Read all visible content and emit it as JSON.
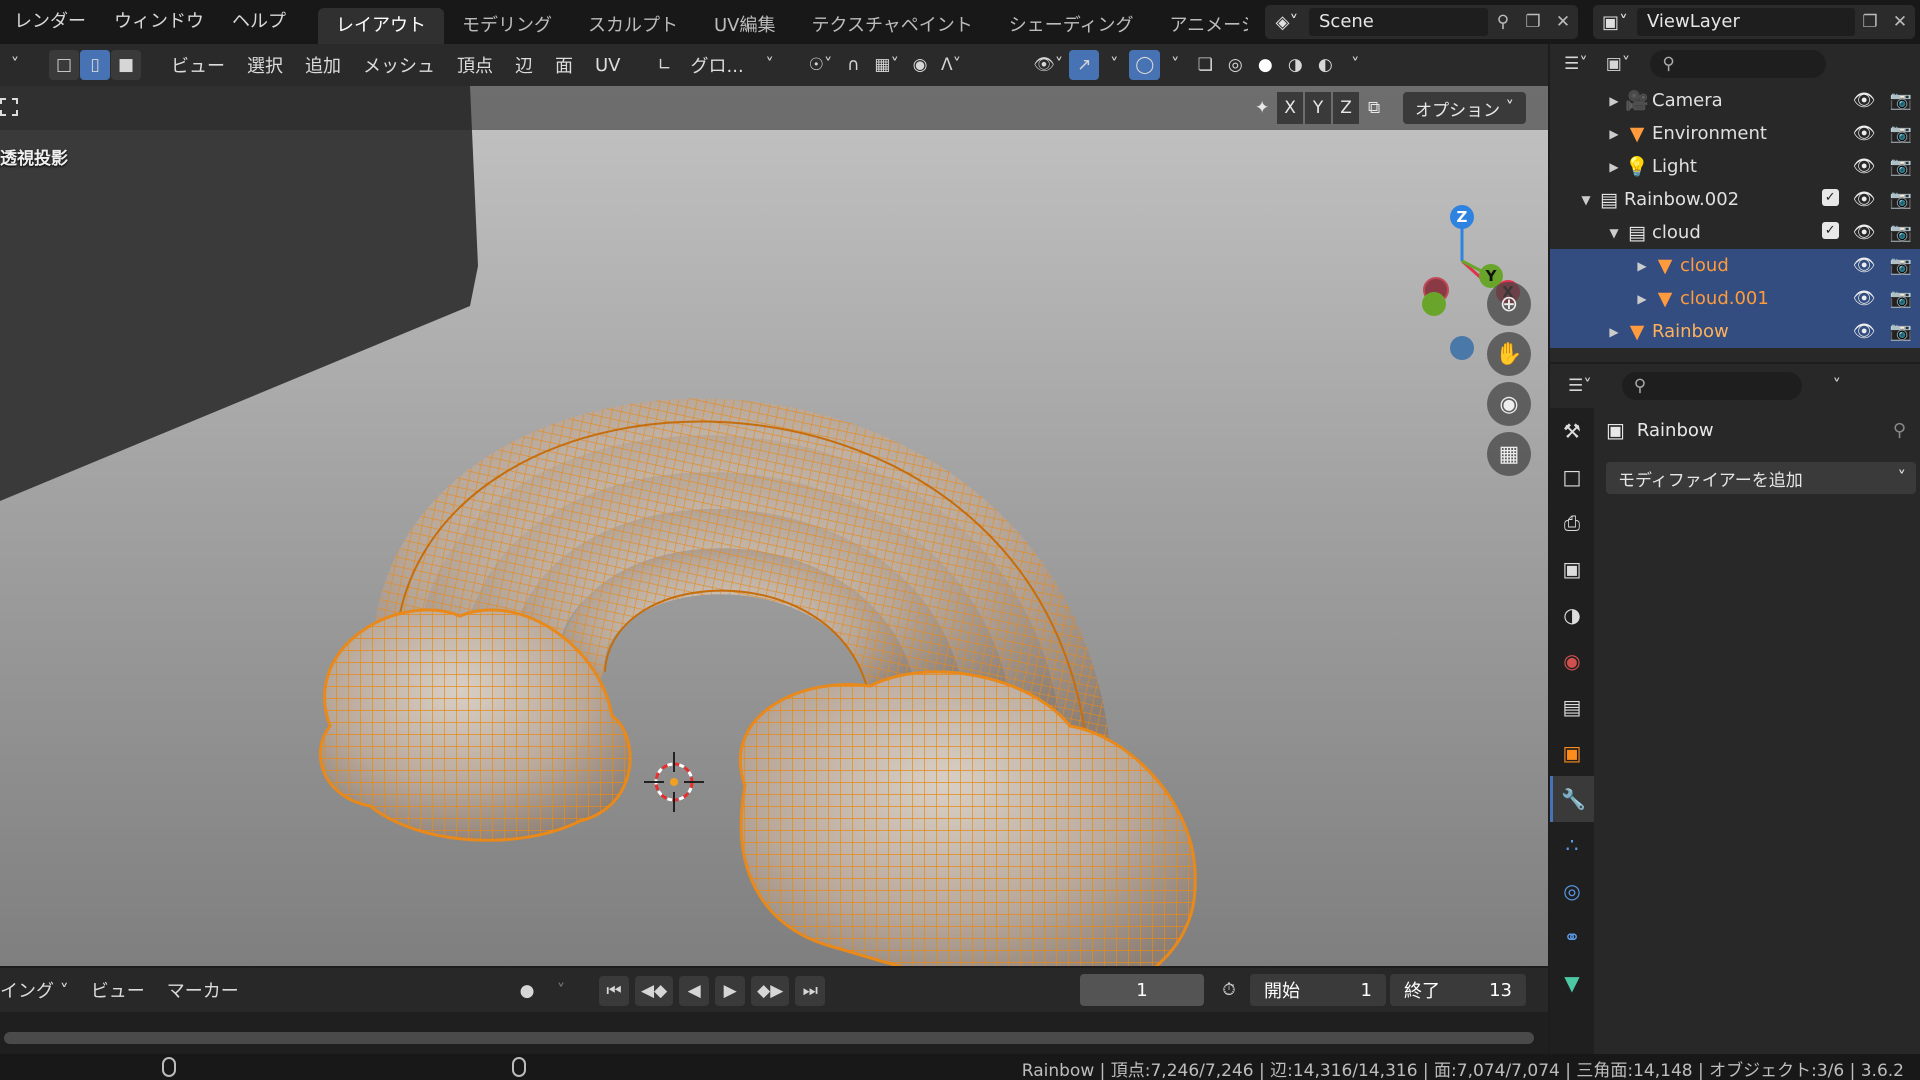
{
  "top_menu": [
    "レンダー",
    "ウィンドウ",
    "ヘルプ"
  ],
  "workspace_tabs": [
    {
      "label": "レイアウト"
    },
    {
      "label": "モデリング"
    },
    {
      "label": "スカルプト"
    },
    {
      "label": "UV編集"
    },
    {
      "label": "テクスチャペイント"
    },
    {
      "label": "シェーディング"
    },
    {
      "label": "アニメーシ"
    }
  ],
  "scene": {
    "name": "Scene"
  },
  "view_layer": {
    "name": "ViewLayer"
  },
  "viewport_header": {
    "menus": [
      "ビュー",
      "選択",
      "追加",
      "メッシュ",
      "頂点",
      "辺",
      "面",
      "UV"
    ],
    "transform_orientation": "グロ..."
  },
  "viewport": {
    "mode_label": "透視投影",
    "axis_buttons": [
      "X",
      "Y",
      "Z"
    ],
    "options_label": "オプション",
    "gizmo_axes": {
      "z": "Z",
      "y": "Y",
      "x": "X"
    }
  },
  "outliner": {
    "rows": [
      {
        "name": "Camera",
        "indent": 2,
        "expanded": false,
        "icon": "camera-icon",
        "selected": false
      },
      {
        "name": "Environment",
        "indent": 2,
        "expanded": false,
        "icon": "mesh-icon",
        "selected": false
      },
      {
        "name": "Light",
        "indent": 2,
        "expanded": false,
        "icon": "light-icon",
        "selected": false
      },
      {
        "name": "Rainbow.002",
        "indent": 1,
        "expanded": true,
        "icon": "collection-icon",
        "selected": false,
        "checkbox": true
      },
      {
        "name": "cloud",
        "indent": 2,
        "expanded": true,
        "icon": "collection-icon",
        "selected": false,
        "checkbox": true
      },
      {
        "name": "cloud",
        "indent": 3,
        "expanded": false,
        "icon": "mesh-icon",
        "selected": true,
        "orange": true
      },
      {
        "name": "cloud.001",
        "indent": 3,
        "expanded": false,
        "icon": "mesh-icon",
        "selected": true,
        "orange": true
      },
      {
        "name": "Rainbow",
        "indent": 2,
        "expanded": false,
        "icon": "mesh-icon",
        "selected": true,
        "active": true
      }
    ]
  },
  "properties": {
    "object_name": "Rainbow",
    "add_modifier_label": "モディファイアーを追加"
  },
  "timeline": {
    "mode_label": "イング",
    "menus": [
      "ビュー",
      "マーカー"
    ],
    "current_frame": "1",
    "start_label": "開始",
    "start_value": "1",
    "end_label": "終了",
    "end_value": "13"
  },
  "status_bar": {
    "text": "Rainbow | 頂点:7,246/7,246 | 辺:14,316/14,316 | 面:7,074/7,074 | 三角面:14,148 | オブジェクト:3/6 | 3.6.2"
  },
  "colors": {
    "accent": "#4772b3",
    "selection_orange": "#ff9b3d",
    "wire_orange": "#e8891a"
  }
}
